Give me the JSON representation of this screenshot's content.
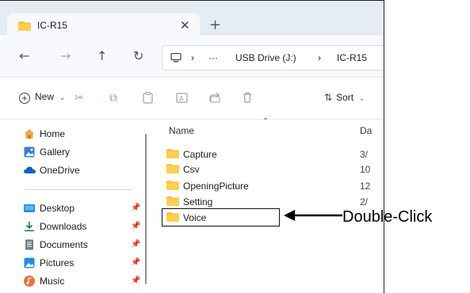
{
  "window": {
    "tab_title": "IC-R15",
    "close_glyph": "✕",
    "newtab_glyph": "+"
  },
  "nav": {
    "back": "←",
    "forward": "→",
    "up": "↑",
    "refresh": "↻",
    "more": "···",
    "chevron": "›",
    "breadcrumb": [
      "USB Drive (J:)",
      "IC-R15"
    ]
  },
  "toolbar": {
    "new_label": "New",
    "new_caret": "⌄",
    "sort_label": "Sort",
    "sort_caret": "⌄"
  },
  "sidebar": {
    "items": [
      {
        "label": "Home",
        "icon": "home-icon",
        "pinned": false
      },
      {
        "label": "Gallery",
        "icon": "gallery-icon",
        "pinned": false
      },
      {
        "label": "OneDrive",
        "icon": "cloud-icon",
        "pinned": false
      },
      {
        "label": "Desktop",
        "icon": "desktop-icon",
        "pinned": true
      },
      {
        "label": "Downloads",
        "icon": "download-icon",
        "pinned": true
      },
      {
        "label": "Documents",
        "icon": "document-icon",
        "pinned": true
      },
      {
        "label": "Pictures",
        "icon": "pictures-icon",
        "pinned": true
      },
      {
        "label": "Music",
        "icon": "music-icon",
        "pinned": true
      }
    ]
  },
  "files": {
    "header_name": "Name",
    "header_date": "Da",
    "rows": [
      {
        "name": "Capture",
        "date": "3/"
      },
      {
        "name": "Csv",
        "date": "10"
      },
      {
        "name": "OpeningPicture",
        "date": "12"
      },
      {
        "name": "Setting",
        "date": "2/"
      },
      {
        "name": "Voice",
        "date": ""
      }
    ]
  },
  "annotation": {
    "callout": "Double-Click"
  },
  "colors": {
    "folder": "#f7c23c",
    "accent": "#0a64c8",
    "tabbar": "#e6ecf4"
  }
}
